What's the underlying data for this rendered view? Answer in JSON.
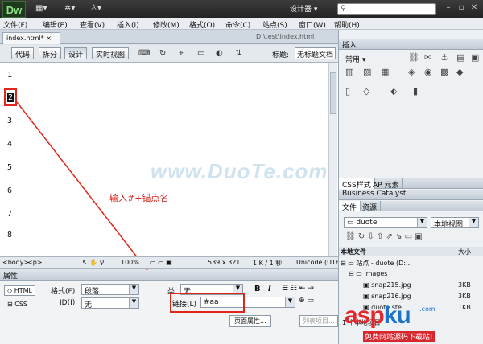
{
  "app": {
    "logo": "Dw",
    "workspace": "设计器 ▾",
    "search_placeholder": ""
  },
  "menu": [
    "文件(F)",
    "编辑(E)",
    "查看(V)",
    "插入(I)",
    "修改(M)",
    "格式(O)",
    "命令(C)",
    "站点(S)",
    "窗口(W)",
    "帮助(H)"
  ],
  "doc": {
    "tab": "index.html*",
    "close": "×",
    "path": "D:\\test\\index.html"
  },
  "views": {
    "code": "代码",
    "split": "拆分",
    "design": "设计",
    "live": "实时视图",
    "title_label": "标题:",
    "title_value": "无标题文档"
  },
  "lines": [
    "1",
    "2",
    "3",
    "4",
    "5",
    "6",
    "7",
    "8"
  ],
  "watermark": "www.DuoTe.com",
  "annotation": "输入#+锚点名",
  "status": {
    "tags": "<body>",
    "zoom": "100%",
    "size": "539 x 321",
    "info": "1 K / 1 秒",
    "encoding": "Unicode (UTF"
  },
  "props": {
    "panel_title": "属性",
    "html_btn": "HTML",
    "css_btn": "CSS",
    "format_label": "格式(F)",
    "format_value": "段落",
    "class_label": "类",
    "class_value": "无",
    "id_label": "ID(I)",
    "id_value": "无",
    "link_label": "链接(L)",
    "link_value": "#aa",
    "bold": "B",
    "italic": "I",
    "page_props": "页面属性...",
    "list_item": "列表项目..."
  },
  "insert": {
    "title": "插入",
    "category": "常用 ▾"
  },
  "css": {
    "tab1": "CSS样式",
    "tab2": "AP 元素",
    "bc": "Business Catalyst"
  },
  "files": {
    "tab1": "文件",
    "tab2": "资源",
    "site": "duote",
    "view": "本地视图",
    "col_local": "本地文件",
    "col_size": "大小",
    "rows": [
      {
        "name": "站点 - duote (D:...",
        "size": ""
      },
      {
        "name": "images",
        "size": ""
      },
      {
        "name": "snap215.jpg",
        "size": "3KB"
      },
      {
        "name": "snap216.jpg",
        "size": "3KB"
      },
      {
        "name": "duote.ste",
        "size": "1KB"
      }
    ],
    "status": "1 个本地项目"
  },
  "brand": {
    "main": "asp",
    "k": "ku",
    "sub": ".com",
    "tag": "免费网站源码下载站!"
  }
}
